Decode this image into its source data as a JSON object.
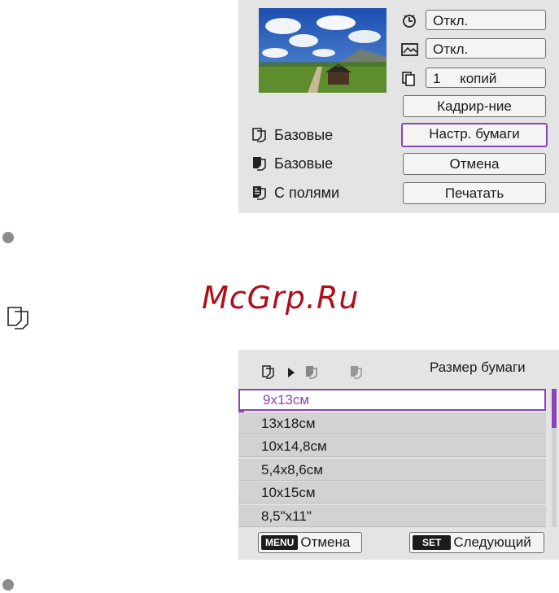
{
  "print_panel": {
    "settings": [
      {
        "icon": "date-print-icon",
        "value": "Откл."
      },
      {
        "icon": "effect-icon",
        "value": "Откл."
      },
      {
        "icon": "copies-icon",
        "value": "1     копий"
      }
    ],
    "buttons": {
      "crop": "Кадрир-ние",
      "paper_settings": "Настр. бумаги",
      "cancel": "Отмена",
      "print": "Печатать"
    },
    "paper_info": [
      {
        "icon": "paper-size-icon",
        "label": "Базовые"
      },
      {
        "icon": "paper-type-icon",
        "label": "Базовые"
      },
      {
        "icon": "page-layout-icon",
        "label": "С полями"
      }
    ]
  },
  "watermark": "McGrp.Ru",
  "paper_size_panel": {
    "title": "Размер бумаги",
    "sizes": [
      "9x13см",
      "13x18см",
      "10x14,8см",
      "5,4x8,6см",
      "10x15см",
      "8,5\"x11\""
    ],
    "selected_index": 0,
    "footer": {
      "menu_key": "MENU",
      "menu_label": "Отмена",
      "set_key": "SET",
      "set_label": "Следующий"
    }
  },
  "colors": {
    "accent": "#8a44b8",
    "panel_bg": "#e4e4e4",
    "watermark": "#b10e1c"
  }
}
